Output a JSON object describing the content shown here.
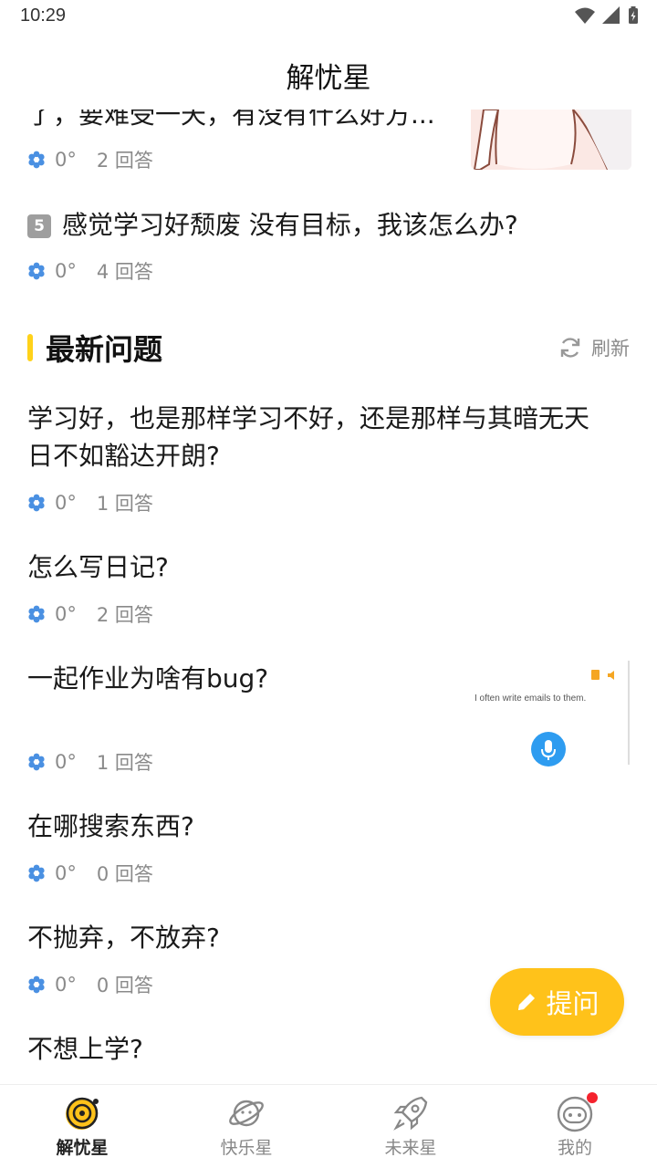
{
  "status_bar": {
    "time": "10:29"
  },
  "header": {
    "title": "解忧星"
  },
  "hot_questions": [
    {
      "partial_title": "了，要难受一天，有没有什么好方...",
      "degree": "0°",
      "answers": "2 回答"
    },
    {
      "rank": "5",
      "title": "感觉学习好颓废 没有目标，我该怎么办?",
      "degree": "0°",
      "answers": "4 回答"
    }
  ],
  "latest": {
    "section_title": "最新问题",
    "refresh_label": "刷新",
    "questions": [
      {
        "title_line1": "学习好，也是那样学习不好，还是那样与其暗无天",
        "title_line2": "日不如豁达开朗?",
        "degree": "0°",
        "answers": "1 回答"
      },
      {
        "title": "怎么写日记?",
        "degree": "0°",
        "answers": "2 回答"
      },
      {
        "title": "一起作业为啥有bug?",
        "degree": "0°",
        "answers": "1 回答",
        "thumb_text": "I often write emails to them."
      },
      {
        "title": "在哪搜索东西?",
        "degree": "0°",
        "answers": "0 回答"
      },
      {
        "title": "不抛弃，不放弃?",
        "degree": "0°",
        "answers": "0 回答"
      },
      {
        "title": "不想上学?"
      }
    ]
  },
  "fab": {
    "label": "提问"
  },
  "tabs": [
    {
      "label": "解忧星",
      "icon": "worry-planet-icon",
      "active": true
    },
    {
      "label": "快乐星",
      "icon": "happy-planet-icon"
    },
    {
      "label": "未来星",
      "icon": "rocket-icon"
    },
    {
      "label": "我的",
      "icon": "robot-avatar-icon",
      "badge": true
    }
  ],
  "colors": {
    "accent": "#ffc21a",
    "star_icon": "#4a90e2",
    "badge_red": "#f5222d"
  }
}
